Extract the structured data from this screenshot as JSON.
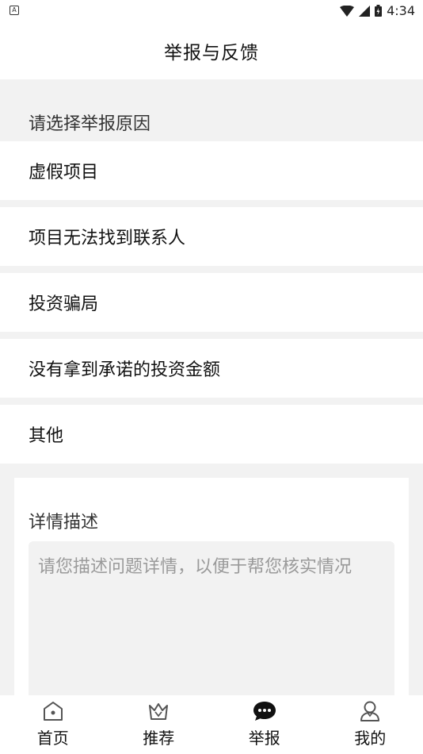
{
  "status_bar": {
    "left_badge": "A",
    "time": "4:34"
  },
  "header": {
    "title": "举报与反馈"
  },
  "reason_section": {
    "label": "请选择举报原因",
    "items": [
      {
        "label": "虚假项目"
      },
      {
        "label": "项目无法找到联系人"
      },
      {
        "label": "投资骗局"
      },
      {
        "label": "没有拿到承诺的投资金额"
      },
      {
        "label": "其他"
      }
    ]
  },
  "detail": {
    "label": "详情描述",
    "placeholder": "请您描述问题详情，以便于帮您核实情况",
    "value": ""
  },
  "tabbar": {
    "tabs": [
      {
        "label": "首页",
        "icon": "home-icon"
      },
      {
        "label": "推荐",
        "icon": "crown-icon"
      },
      {
        "label": "举报",
        "icon": "chat-bubble-icon",
        "active": true
      },
      {
        "label": "我的",
        "icon": "user-icon"
      }
    ]
  }
}
